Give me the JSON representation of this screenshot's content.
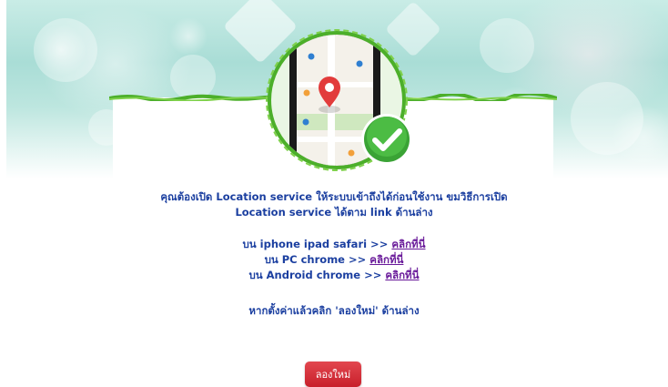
{
  "instructions": {
    "line1": "คุณต้องเปิด Location service ให้ระบบเข้าถึงได้ก่อนใช้งาน ขมวิธีการเปิด",
    "line2": "Location service ได้ตาม link ด้านล่าง"
  },
  "platforms": [
    {
      "label": "บน iphone ipad safari >> ",
      "link": "คลิกที่นี่"
    },
    {
      "label": "บน PC chrome >> ",
      "link": "คลิกที่นี่"
    },
    {
      "label": "บน Android chrome >> ",
      "link": "คลิกที่นี่"
    }
  ],
  "footer_hint": "หากตั้งค่าแล้วคลิก 'ลองใหม่' ด้านล่าง",
  "retry_button": "ลองใหม่",
  "colors": {
    "text": "#1b3fa0",
    "link": "#6a1b9a",
    "button": "#c8202b",
    "badge": "#3aa335"
  },
  "icons": {
    "hero": "phone-map-pin-icon",
    "badge": "check-circle-icon"
  }
}
